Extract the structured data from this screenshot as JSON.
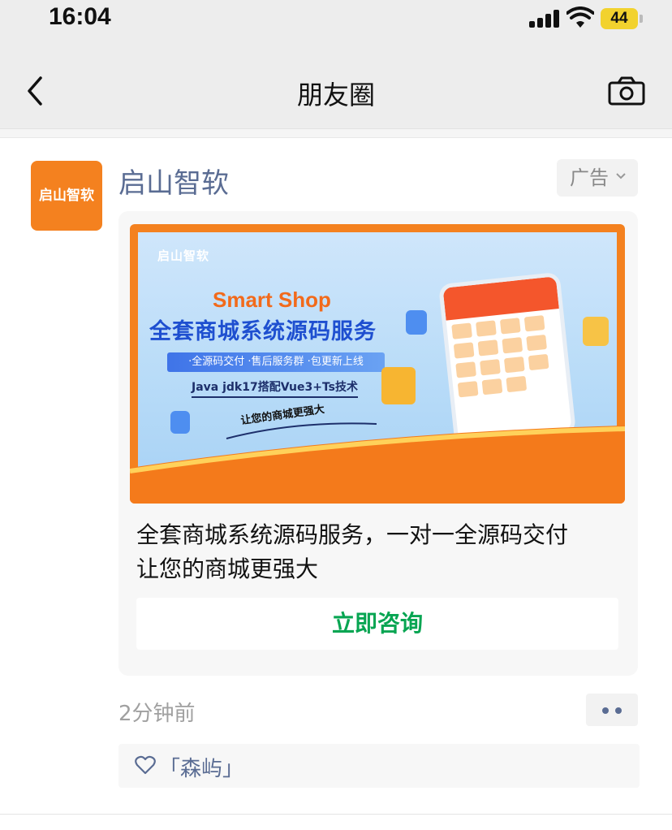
{
  "status_bar": {
    "time": "16:04",
    "battery": "44"
  },
  "nav": {
    "title": "朋友圈",
    "back_icon": "chevron-left-icon",
    "camera_icon": "camera-icon"
  },
  "post": {
    "author": "启山智软",
    "avatar_text": "启山智软",
    "ad_label": "广告",
    "banner": {
      "logo": "启山智软",
      "headline": "Smart Shop",
      "subheadline": "全套商城系统源码服务",
      "features": "·全源码交付 ·售后服务群 ·包更新上线",
      "tech": "Java jdk17搭配Vue3+Ts技术",
      "slogan": "让您的商城更强大"
    },
    "text_line1": "全套商城系统源码服务，一对一全源码交付",
    "text_line2": "让您的商城更强大",
    "cta_label": "立即咨询",
    "time_ago": "2分钟前",
    "likes": "「森屿」"
  },
  "colors": {
    "accent_orange": "#f4811f",
    "link_blue": "#5a6c93",
    "cta_green": "#07a552"
  }
}
